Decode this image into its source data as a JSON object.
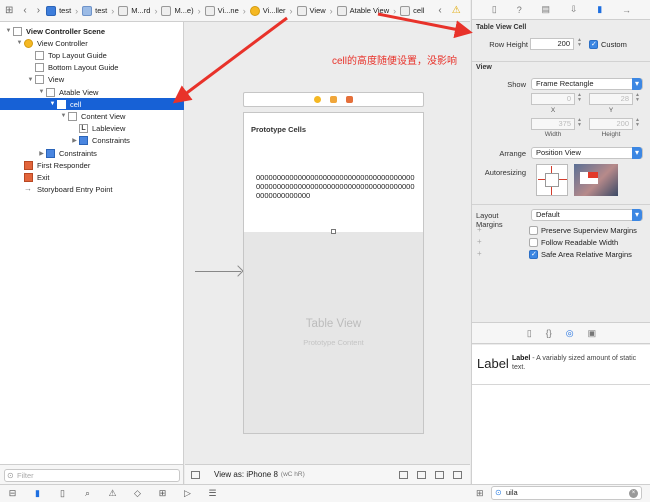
{
  "jumpbar": {
    "crumbs": [
      "test",
      "test",
      "M...rd",
      "M...e)",
      "Vi...ne",
      "Vi...ller",
      "View",
      "Atable View",
      "cell"
    ]
  },
  "outline": {
    "rows": [
      {
        "label": "View Controller Scene",
        "indent": 0,
        "tri": "▼",
        "icon": "doc",
        "sel": false,
        "bold": true
      },
      {
        "label": "View Controller",
        "indent": 1,
        "tri": "▼",
        "icon": "yellow",
        "sel": false
      },
      {
        "label": "Top Layout Guide",
        "indent": 2,
        "tri": "",
        "icon": "doc",
        "sel": false
      },
      {
        "label": "Bottom Layout Guide",
        "indent": 2,
        "tri": "",
        "icon": "doc",
        "sel": false
      },
      {
        "label": "View",
        "indent": 2,
        "tri": "▼",
        "icon": "doc",
        "sel": false
      },
      {
        "label": "Atable View",
        "indent": 3,
        "tri": "▼",
        "icon": "doc",
        "sel": false
      },
      {
        "label": "cell",
        "indent": 4,
        "tri": "▼",
        "icon": "doc",
        "sel": true
      },
      {
        "label": "Content View",
        "indent": 5,
        "tri": "▼",
        "icon": "doc",
        "sel": false
      },
      {
        "label": "Lableview",
        "indent": 6,
        "tri": "",
        "icon": "L",
        "sel": false
      },
      {
        "label": "Constraints",
        "indent": 6,
        "tri": "▶",
        "icon": "blue",
        "sel": false
      },
      {
        "label": "Constraints",
        "indent": 3,
        "tri": "▶",
        "icon": "blue",
        "sel": false
      },
      {
        "label": "First Responder",
        "indent": 1,
        "tri": "",
        "icon": "red",
        "sel": false
      },
      {
        "label": "Exit",
        "indent": 1,
        "tri": "",
        "icon": "red",
        "sel": false
      },
      {
        "label": "Storyboard Entry Point",
        "indent": 1,
        "tri": "",
        "icon": "arrow",
        "sel": false
      }
    ],
    "filter_placeholder": "Filter"
  },
  "canvas": {
    "proto_title": "Prototype Cells",
    "cell_text": "00000000000000000000000000000000000000000000000000000000000000000000000000000000000000000",
    "table_title": "Table View",
    "table_sub": "Prototype Content",
    "annotation": "cell的高度随便设置，没影响"
  },
  "viewas": {
    "label": "View as: iPhone 8",
    "traits": "(wC hR)"
  },
  "inspector": {
    "section1": "Table View Cell",
    "row_height_label": "Row Height",
    "row_height_value": "200",
    "custom_label": "Custom",
    "section2": "View",
    "show_label": "Show",
    "show_value": "Frame Rectangle",
    "x_value": "0",
    "y_value": "28",
    "x_label": "X",
    "y_label": "Y",
    "width_value": "375",
    "height_value": "200",
    "width_label": "Width",
    "height_label": "Height",
    "arrange_label": "Arrange",
    "arrange_value": "Position View",
    "autoresizing_label": "Autoresizing",
    "layout_margins_label": "Layout Margins",
    "layout_margins_value": "Default",
    "chk1": "Preserve Superview Margins",
    "chk2": "Follow Readable Width",
    "chk3": "Safe Area Relative Margins",
    "lib_big": "Label",
    "lib_name": "Label",
    "lib_desc": " - A variably sized amount of static text.",
    "lib_search": "uila"
  },
  "colors": {
    "selection": "#1761d6",
    "accent": "#3c87e3",
    "annotation": "#e8322a"
  }
}
